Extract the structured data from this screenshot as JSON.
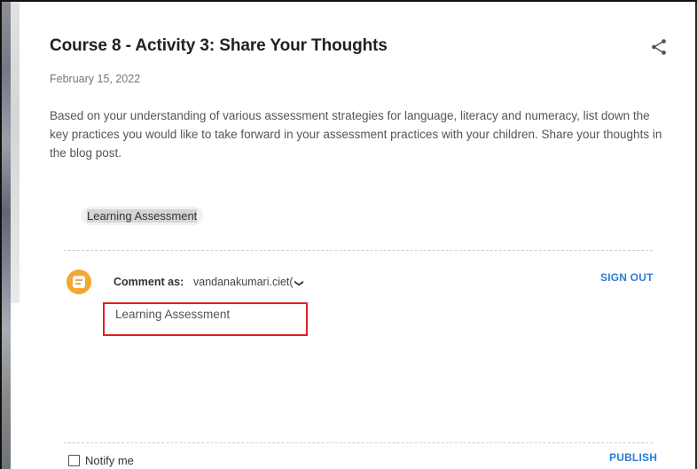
{
  "post": {
    "title": "Course 8 - Activity 3: Share Your Thoughts",
    "date": "February 15, 2022",
    "body": "Based on your understanding of various assessment strategies for language, literacy and numeracy, list down the key practices you would like to take forward in your assessment practices with your children. Share your thoughts in the blog post.",
    "label": "Learning Assessment",
    "share_icon": "share-icon"
  },
  "comment": {
    "comment_as_label": "Comment as:",
    "account": "vandanakumari.ciet(",
    "sign_out_label": "SIGN OUT",
    "text": "Learning Assessment",
    "notify_label": "Notify me",
    "notify_checked": false,
    "publish_label": "PUBLISH",
    "avatar_icon": "blogger-icon"
  },
  "colors": {
    "accent": "#2a7fd4",
    "highlight_border": "#e02020",
    "blogger_orange": "#f4a732"
  }
}
